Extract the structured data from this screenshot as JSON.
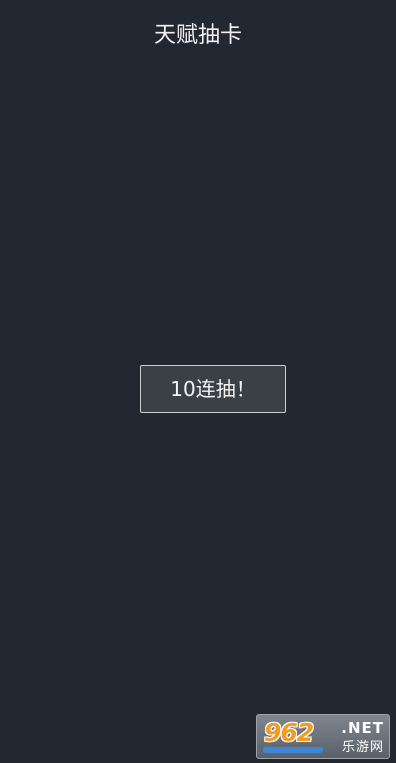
{
  "header": {
    "title": "天赋抽卡"
  },
  "main": {
    "draw_button_label": "10连抽！"
  },
  "watermark": {
    "number": "962",
    "domain": ".NET",
    "site_name": "乐游网"
  },
  "colors": {
    "background": "#222832",
    "button_background": "#3b3f46",
    "button_border": "#c9ccd0",
    "text": "#ffffff",
    "watermark_accent": "#f39a24"
  }
}
